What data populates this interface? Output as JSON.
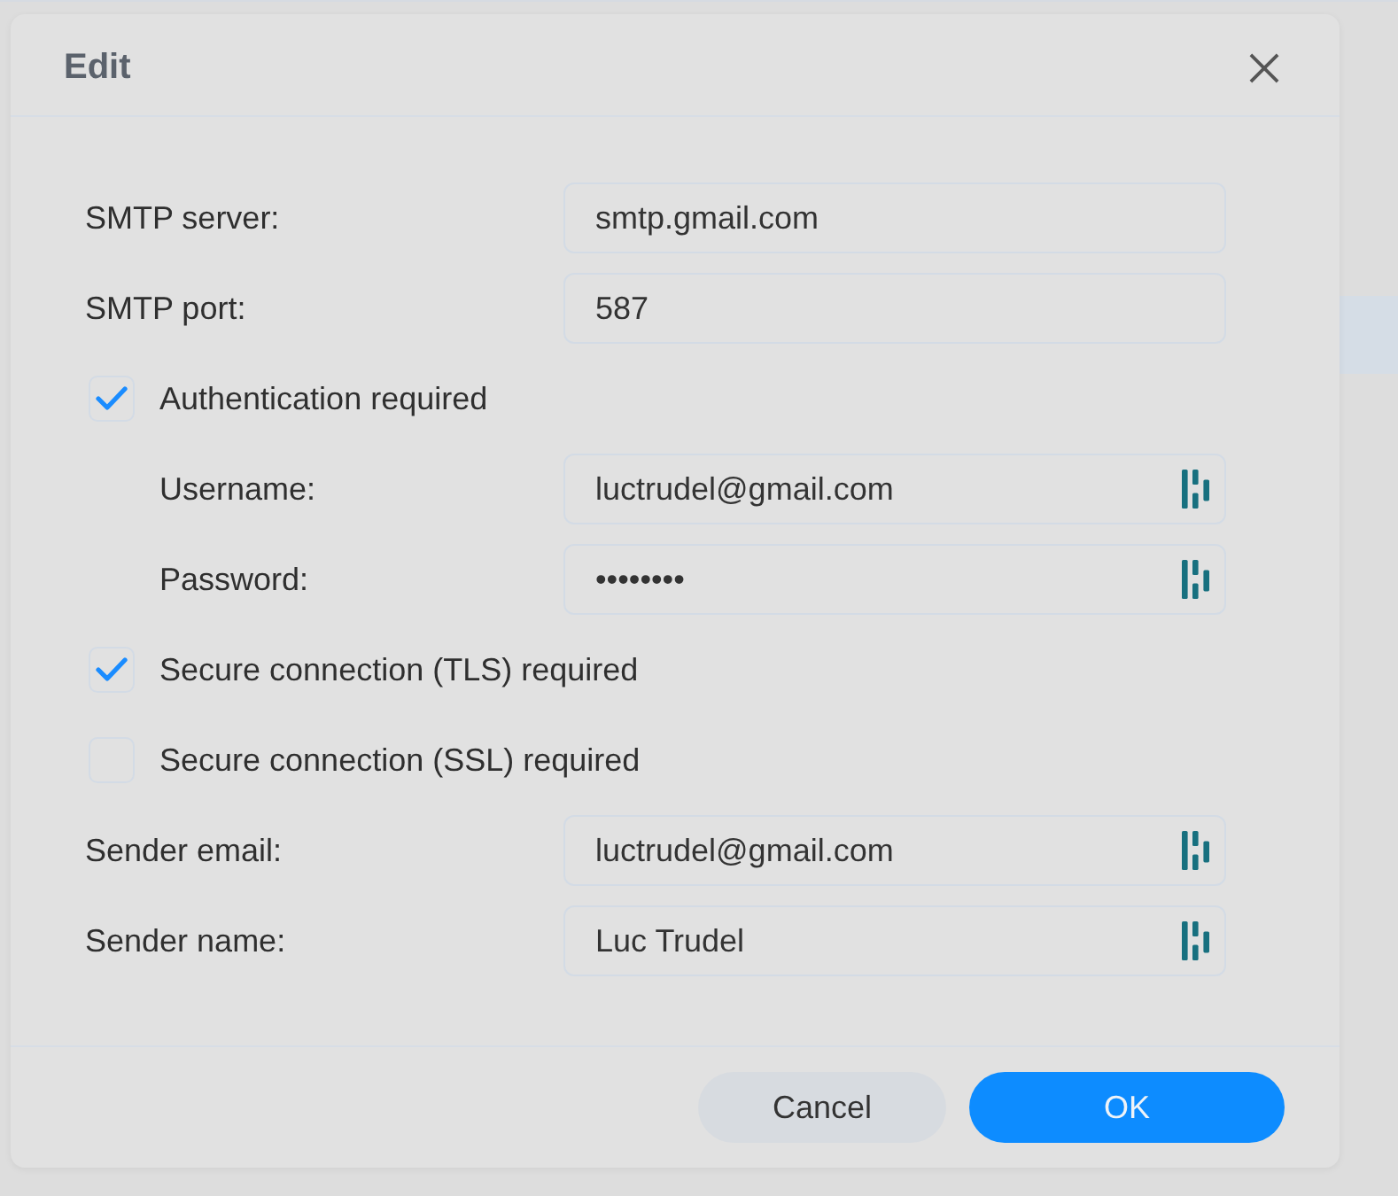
{
  "dialog": {
    "title": "Edit"
  },
  "rows": [
    {
      "kind": "field",
      "label": "SMTP server:",
      "value": "smtp.gmail.com",
      "fill_icon": false
    },
    {
      "kind": "field",
      "label": "SMTP port:",
      "value": "587",
      "fill_icon": false
    },
    {
      "kind": "checkbox",
      "label": "Authentication required",
      "checked": true,
      "children": [
        {
          "kind": "field",
          "label": "Username:",
          "value": "luctrudel@gmail.com",
          "fill_icon": true
        },
        {
          "kind": "field",
          "label": "Password:",
          "value": "••••••••",
          "fill_icon": true
        }
      ]
    },
    {
      "kind": "checkbox",
      "label": "Secure connection (TLS) required",
      "checked": true
    },
    {
      "kind": "checkbox",
      "label": "Secure connection (SSL) required",
      "checked": false
    },
    {
      "kind": "field",
      "label": "Sender email:",
      "value": "luctrudel@gmail.com",
      "fill_icon": true
    },
    {
      "kind": "field",
      "label": "Sender name:",
      "value": "Luc Trudel",
      "fill_icon": true
    }
  ],
  "buttons": [
    {
      "label": "Cancel",
      "kind": "secondary"
    },
    {
      "label": "OK",
      "kind": "primary"
    }
  ]
}
